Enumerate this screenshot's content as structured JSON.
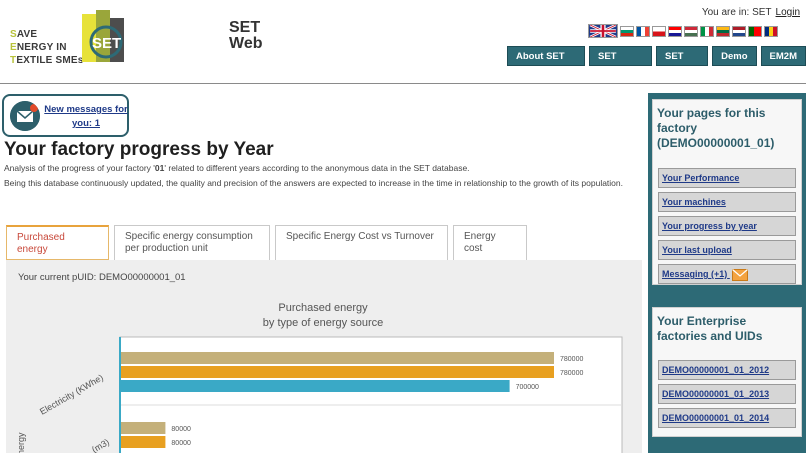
{
  "logo": {
    "lines": [
      [
        "S",
        "AVE"
      ],
      [
        "E",
        "NERGY IN"
      ],
      [
        "T",
        "EXTILE SMEs"
      ]
    ],
    "mark_text": "SET"
  },
  "site": {
    "title_line1": "SET",
    "title_line2": "Web"
  },
  "user": {
    "you_are_in": "You are in: SET",
    "login": "Login"
  },
  "flags": [
    "uk",
    "bg",
    "fr",
    "cz",
    "hr",
    "hu",
    "it",
    "lt",
    "nl",
    "pt",
    "ro"
  ],
  "nav": [
    "About SET Web",
    "SET Project",
    "SET Tool",
    "Demo",
    "EM2M"
  ],
  "messages": {
    "link": "New messages for you: 1"
  },
  "page": {
    "title": "Your factory progress by Year",
    "intro_1_pre": "Analysis of the progress of your factory '",
    "intro_1_code": "01",
    "intro_1_post": "' related to different years according to the anonymous data in the SET database.",
    "intro_2": "Being this database continuously updated, the quality and precision of the answers are expected to increase in the time in relationship to the growth of its population."
  },
  "tabs": [
    {
      "label": "Purchased energy",
      "active": true
    },
    {
      "label": "Specific energy consumption per production unit",
      "active": false
    },
    {
      "label": "Specific Energy Cost vs Turnover",
      "active": false
    },
    {
      "label": "Energy cost",
      "active": false
    }
  ],
  "panel": {
    "puid_label": "Your current pUID: DEMO00000001_01"
  },
  "chart_data": {
    "type": "bar",
    "orientation": "horizontal",
    "title": "Purchased energy",
    "subtitle": "by type of energy source",
    "ylabel": "energy",
    "categories": [
      "Electricity (KWhe)",
      "(m3)"
    ],
    "series": [
      {
        "color": "#c4b07a",
        "values": [
          780000,
          80000
        ]
      },
      {
        "color": "#e8a020",
        "values": [
          780000,
          80000
        ]
      },
      {
        "color": "#3aa9c6",
        "values": [
          700000,
          null
        ]
      }
    ],
    "grid": true
  },
  "sidebar": {
    "pages_title": "Your pages for this factory (DEMO00000001_01)",
    "pages": [
      "Your Performance",
      "Your machines",
      "Your progress by year",
      "Your last upload",
      "Messaging (+1)"
    ],
    "enterprise_title": "Your Enterprise factories and UIDs",
    "enterprise": [
      "DEMO00000001_01_2012",
      "DEMO00000001_01_2013",
      "DEMO00000001_01_2014"
    ]
  },
  "colors": {
    "accent": "#2d6a76",
    "link": "#1f3a88",
    "active_tab": "#c8483a"
  }
}
